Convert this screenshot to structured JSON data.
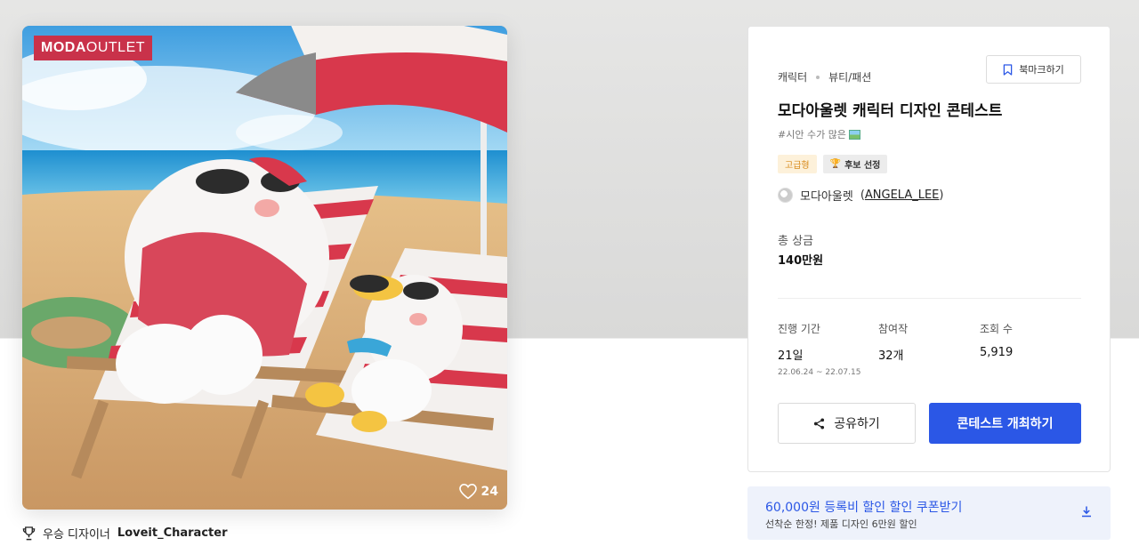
{
  "hero": {
    "brand_logo_bold": "MODA",
    "brand_logo_light": "OUTLET",
    "like_count": "24",
    "colors": {
      "brand": "#c9324a",
      "sky": "#5bb6e8",
      "sand": "#d9b38a"
    }
  },
  "winner": {
    "prefix": "우승 디자이너",
    "name": "Loveit_Character"
  },
  "info": {
    "breadcrumbs": [
      "캐릭터",
      "뷰티/패션"
    ],
    "bookmark_label": "북마크하기",
    "title": "모다아울렛 캐릭터 디자인 콘테스트",
    "hashtag": "#시안 수가 많은",
    "badges": {
      "premium": "고급형",
      "candidate": "후보 선정"
    },
    "host": {
      "name": "모다아울렛",
      "open_paren": "(",
      "username": "ANGELA_LEE",
      "close_paren": ")"
    },
    "prize": {
      "label": "총 상금",
      "value": "140만원"
    },
    "stats": {
      "period": {
        "label": "진행 기간",
        "value": "21일",
        "range": "22.06.24 ~ 22.07.15"
      },
      "participants": {
        "label": "참여작",
        "value": "32개"
      },
      "views": {
        "label": "조회 수",
        "value": "5,919"
      }
    },
    "share_label": "공유하기",
    "host_contest_label": "콘테스트 개최하기",
    "colors": {
      "primary": "#2b57e6",
      "premium_text": "#d88a1a"
    }
  },
  "coupon": {
    "headline": "60,000원 등록비 할인 할인 쿠폰받기",
    "description": "선착순 한정! 제품 디자인 6만원 할인"
  }
}
